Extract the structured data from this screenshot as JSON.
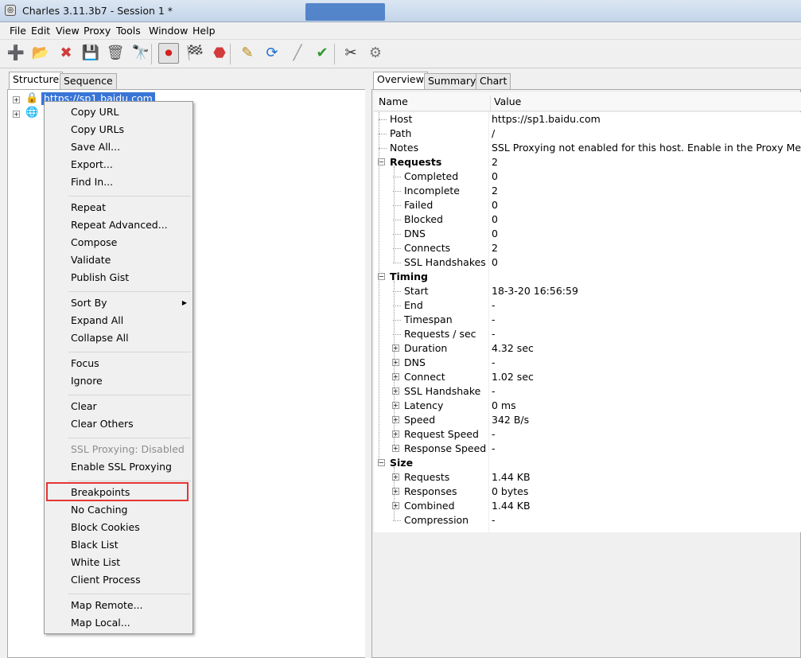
{
  "window": {
    "title": "Charles 3.11.3b7 - Session 1 *"
  },
  "menubar": [
    "File",
    "Edit",
    "View",
    "Proxy",
    "Tools",
    "Window",
    "Help"
  ],
  "toolbar": [
    {
      "icon": "new-session-icon",
      "glyph": "➕",
      "color": "#2f8f2f"
    },
    {
      "icon": "open-folder-icon",
      "glyph": "📂",
      "color": "#4a86d6"
    },
    {
      "icon": "close-session-icon",
      "glyph": "✖",
      "color": "#d23b3b"
    },
    {
      "icon": "save-icon",
      "glyph": "💾",
      "color": "#333333"
    },
    {
      "icon": "trash-icon",
      "glyph": "🗑",
      "color": "#555555"
    },
    {
      "icon": "binoculars-icon",
      "glyph": "🔭",
      "color": "#222222"
    },
    {
      "icon": "record-icon",
      "glyph": "⏺",
      "color": "#d22020"
    },
    {
      "icon": "throttle-flag-icon",
      "glyph": "🏁",
      "color": "#222222"
    },
    {
      "icon": "breakpoints-stop-icon",
      "glyph": "⬣",
      "color": "#d23b3b"
    },
    {
      "icon": "edit-pen-icon",
      "glyph": "✎",
      "color": "#b8860b"
    },
    {
      "icon": "repeat-refresh-icon",
      "glyph": "⟳",
      "color": "#1f6fd1"
    },
    {
      "icon": "validate-pencil-icon",
      "glyph": "╱",
      "color": "#999999"
    },
    {
      "icon": "checkmark-icon",
      "glyph": "✔",
      "color": "#2f9a2f"
    },
    {
      "icon": "tools-icon",
      "glyph": "✂",
      "color": "#333333"
    },
    {
      "icon": "settings-gear-icon",
      "glyph": "⚙",
      "color": "#777777"
    }
  ],
  "left": {
    "tabs": [
      "Structure",
      "Sequence"
    ],
    "tree": {
      "selected_host": "https://sp1.baidu.com"
    }
  },
  "context_menu": {
    "groups": [
      [
        "Copy URL",
        "Copy URLs",
        "Save All...",
        "Export...",
        "Find In..."
      ],
      [
        "Repeat",
        "Repeat Advanced...",
        "Compose",
        "Validate",
        "Publish Gist"
      ],
      [
        "Sort By",
        "Expand All",
        "Collapse All"
      ],
      [
        "Focus",
        "Ignore"
      ],
      [
        "Clear",
        "Clear Others"
      ],
      [
        "SSL Proxying: Disabled",
        "Enable SSL Proxying"
      ],
      [
        "Breakpoints",
        "No Caching",
        "Block Cookies",
        "Black List",
        "White List",
        "Client Process"
      ],
      [
        "Map Remote...",
        "Map Local..."
      ]
    ],
    "disabled": [
      "SSL Proxying: Disabled"
    ],
    "submenu": [
      "Sort By"
    ],
    "highlighted": "Breakpoints",
    "highlight_color": "#e53535"
  },
  "right": {
    "tabs": [
      "Overview",
      "Summary",
      "Chart"
    ],
    "columns": [
      "Name",
      "Value"
    ],
    "rows": [
      {
        "name": "Host",
        "value": "https://sp1.baidu.com",
        "level": 0
      },
      {
        "name": "Path",
        "value": "/",
        "level": 0
      },
      {
        "name": "Notes",
        "value": "SSL Proxying not enabled for this host. Enable in the Proxy Menu, S",
        "level": 0
      },
      {
        "name": "Requests",
        "value": "2",
        "level": 0,
        "bold": true,
        "expander": "minus"
      },
      {
        "name": "Completed",
        "value": "0",
        "level": 1
      },
      {
        "name": "Incomplete",
        "value": "2",
        "level": 1
      },
      {
        "name": "Failed",
        "value": "0",
        "level": 1
      },
      {
        "name": "Blocked",
        "value": "0",
        "level": 1
      },
      {
        "name": "DNS",
        "value": "0",
        "level": 1
      },
      {
        "name": "Connects",
        "value": "2",
        "level": 1
      },
      {
        "name": "SSL Handshakes",
        "value": "0",
        "level": 1
      },
      {
        "name": "Timing",
        "value": "",
        "level": 0,
        "bold": true,
        "expander": "minus"
      },
      {
        "name": "Start",
        "value": "18-3-20 16:56:59",
        "level": 1
      },
      {
        "name": "End",
        "value": "-",
        "level": 1
      },
      {
        "name": "Timespan",
        "value": "-",
        "level": 1
      },
      {
        "name": "Requests / sec",
        "value": "-",
        "level": 1
      },
      {
        "name": "Duration",
        "value": "4.32 sec",
        "level": 1,
        "expander": "plus"
      },
      {
        "name": "DNS",
        "value": "-",
        "level": 1,
        "expander": "plus"
      },
      {
        "name": "Connect",
        "value": "1.02 sec",
        "level": 1,
        "expander": "plus"
      },
      {
        "name": "SSL Handshake",
        "value": "-",
        "level": 1,
        "expander": "plus"
      },
      {
        "name": "Latency",
        "value": "0 ms",
        "level": 1,
        "expander": "plus"
      },
      {
        "name": "Speed",
        "value": "342 B/s",
        "level": 1,
        "expander": "plus"
      },
      {
        "name": "Request Speed",
        "value": "-",
        "level": 1,
        "expander": "plus"
      },
      {
        "name": "Response Speed",
        "value": "-",
        "level": 1,
        "expander": "plus"
      },
      {
        "name": "Size",
        "value": "",
        "level": 0,
        "bold": true,
        "expander": "minus"
      },
      {
        "name": "Requests",
        "value": "1.44 KB",
        "level": 1,
        "expander": "plus"
      },
      {
        "name": "Responses",
        "value": "0 bytes",
        "level": 1,
        "expander": "plus"
      },
      {
        "name": "Combined",
        "value": "1.44 KB",
        "level": 1,
        "expander": "plus"
      },
      {
        "name": "Compression",
        "value": "-",
        "level": 1
      }
    ]
  }
}
